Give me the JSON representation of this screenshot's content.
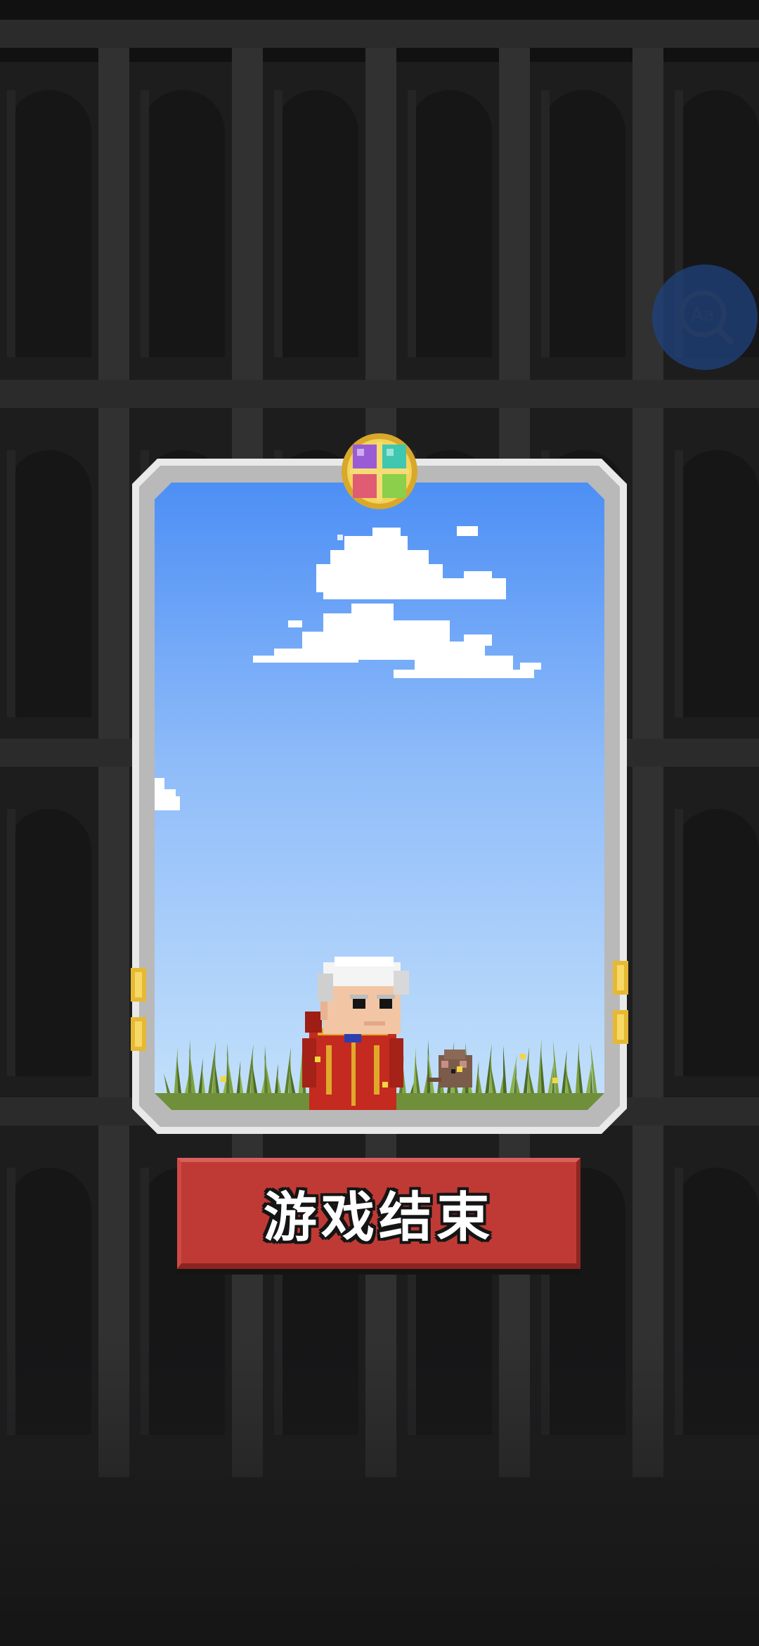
{
  "screen": {
    "background_color": "#1d1d1e",
    "arch_color": "#252526",
    "pillar_color": "#313132"
  },
  "accessibility_button": {
    "label": "Aa",
    "icon": "font-size-magnifier-icon"
  },
  "card": {
    "frame_color": "#e9e9e9",
    "sky_top_color": "#4d8ff5",
    "sky_bottom_color": "#c4e1fb",
    "emblem_icon": "four-color-gem-emblem-icon",
    "character": "old-man-red-robe-sprite",
    "companion": "rat-sprite"
  },
  "game_over_button": {
    "label": "游戏结束",
    "color": "#c03a35"
  }
}
